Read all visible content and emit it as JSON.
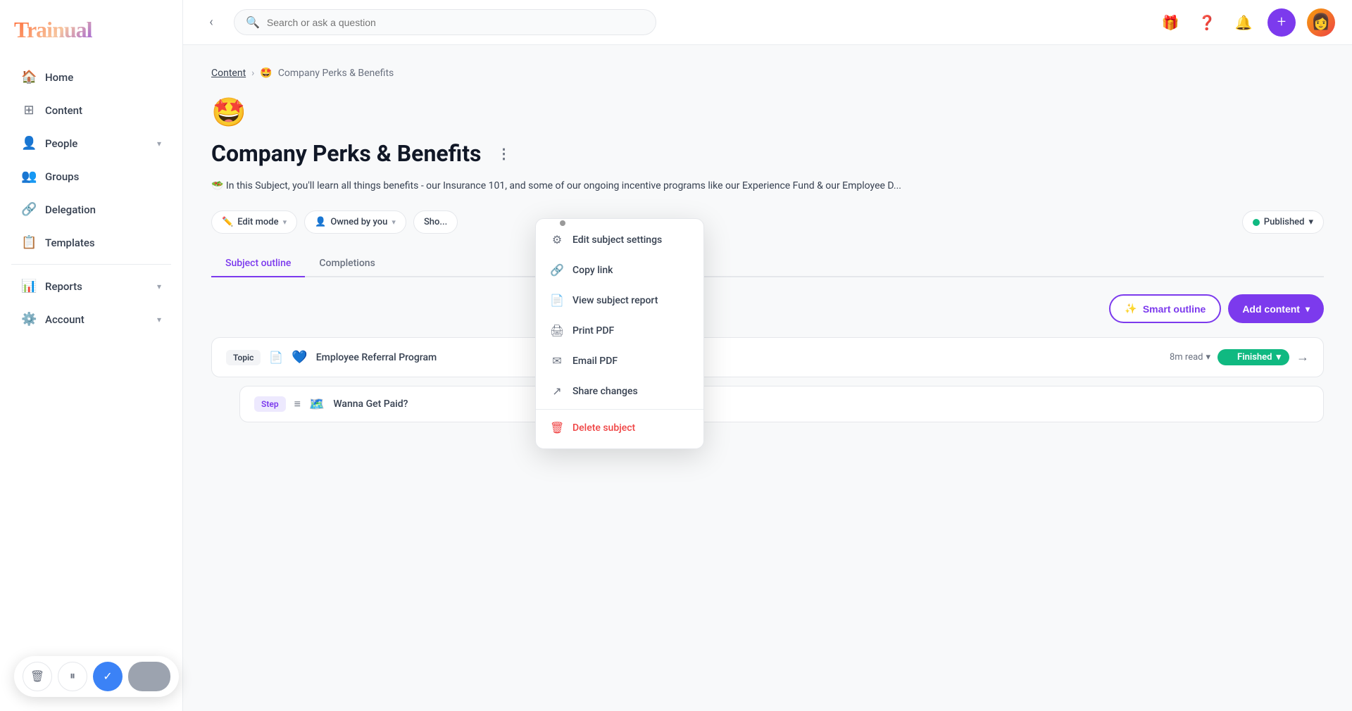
{
  "app": {
    "name": "Trainual"
  },
  "sidebar": {
    "nav_items": [
      {
        "id": "home",
        "label": "Home",
        "icon": "🏠",
        "has_chevron": false
      },
      {
        "id": "content",
        "label": "Content",
        "icon": "⊞",
        "has_chevron": false
      },
      {
        "id": "people",
        "label": "People",
        "icon": "👤",
        "has_chevron": true
      },
      {
        "id": "groups",
        "label": "Groups",
        "icon": "👥",
        "has_chevron": false
      },
      {
        "id": "delegation",
        "label": "Delegation",
        "icon": "🔗",
        "has_chevron": false
      },
      {
        "id": "templates",
        "label": "Templates",
        "icon": "📋",
        "has_chevron": false
      },
      {
        "id": "reports",
        "label": "Reports",
        "icon": "📊",
        "has_chevron": true
      },
      {
        "id": "account",
        "label": "Account",
        "icon": "⚙️",
        "has_chevron": true
      }
    ]
  },
  "header": {
    "search_placeholder": "Search or ask a question",
    "collapse_icon": "‹"
  },
  "breadcrumb": {
    "parent": "Content",
    "current": "Company Perks & Benefits",
    "current_emoji": "🤩"
  },
  "subject": {
    "emoji": "🤩",
    "title": "Company Perks & Benefits",
    "description": "🥗 In this Subject, you'll learn all things benefits - our Insurance 101, and some of our ongoing incentive programs like our Experience Fund & our Employee D...",
    "more_icon": "⋮"
  },
  "toolbar": {
    "edit_mode_label": "Edit mode",
    "owned_by_label": "Owned by you",
    "share_label": "Sho",
    "read_label": "read",
    "published_label": "Published"
  },
  "tabs": [
    {
      "id": "subject-outline",
      "label": "Subject outline",
      "active": true
    },
    {
      "id": "completions",
      "label": "Completions",
      "active": false
    }
  ],
  "actions": {
    "smart_outline_label": "Smart outline",
    "add_content_label": "Add content"
  },
  "topic": {
    "badge": "Topic",
    "icon": "📄",
    "emoji": "💙",
    "title": "Employee Referral Program",
    "read_time": "8m read",
    "status": "Finished"
  },
  "step": {
    "badge": "Step",
    "icon": "≡",
    "emoji": "🗺️",
    "title": "Wanna Get Paid?"
  },
  "dropdown_menu": {
    "items": [
      {
        "id": "edit-subject-settings",
        "label": "Edit subject settings",
        "icon": "⚙"
      },
      {
        "id": "copy-link",
        "label": "Copy link",
        "icon": "🔗"
      },
      {
        "id": "view-subject-report",
        "label": "View subject report",
        "icon": "📄"
      },
      {
        "id": "print-pdf",
        "label": "Print PDF",
        "icon": "🖨"
      },
      {
        "id": "email-pdf",
        "label": "Email PDF",
        "icon": "✉"
      },
      {
        "id": "share-changes",
        "label": "Share changes",
        "icon": "↗"
      },
      {
        "id": "delete-subject",
        "label": "Delete subject",
        "icon": "🗑",
        "danger": true
      }
    ]
  },
  "bottom_controls": {
    "delete_icon": "🗑",
    "pause_icon": "⏸",
    "check_icon": "✓"
  }
}
